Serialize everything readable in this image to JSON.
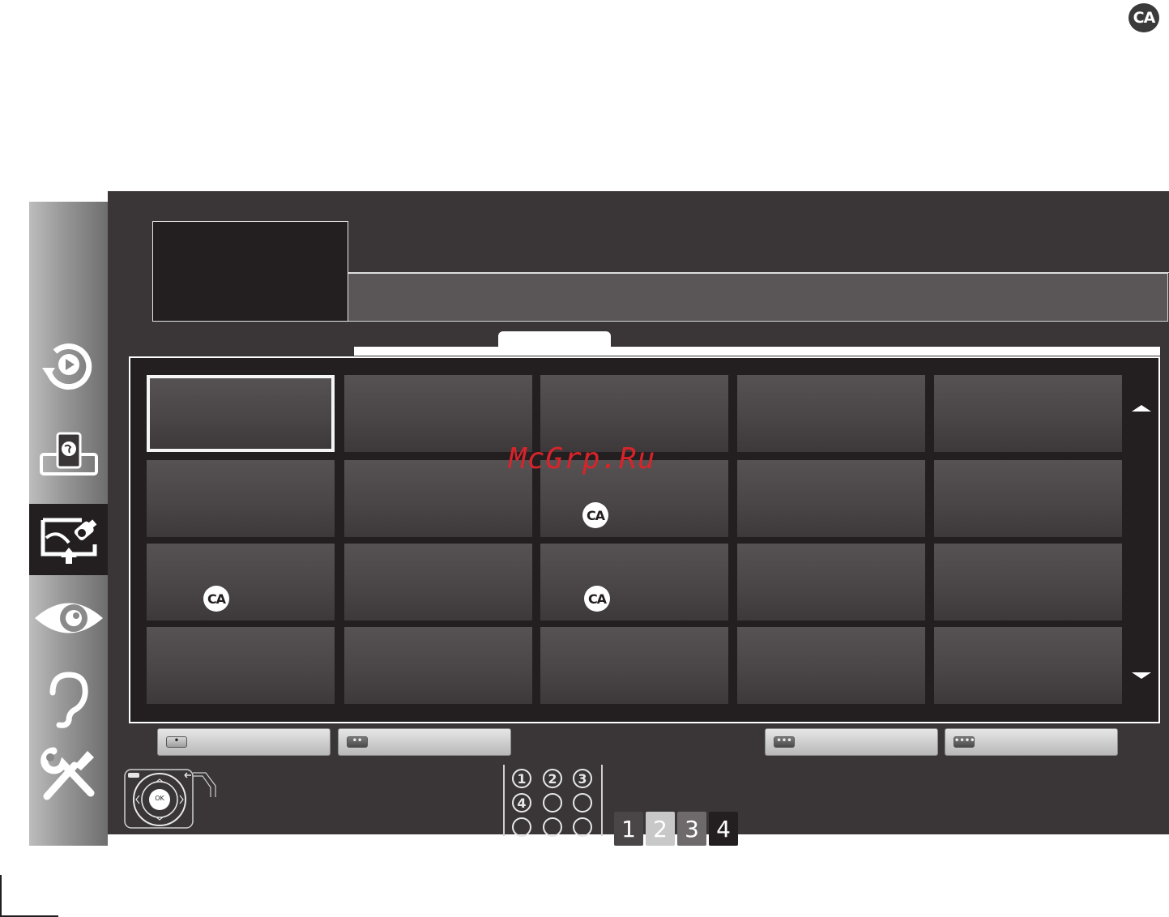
{
  "page_badge": "CA",
  "sidebar": {
    "items": [
      {
        "name": "media-playback",
        "icon": "play-circle-icon",
        "active": false
      },
      {
        "name": "internet",
        "icon": "globe-devices-icon",
        "active": false
      },
      {
        "name": "source",
        "icon": "antenna-cable-icon",
        "active": true
      },
      {
        "name": "picture",
        "icon": "eye-icon",
        "active": false
      },
      {
        "name": "sound",
        "icon": "ear-icon",
        "active": false
      },
      {
        "name": "settings",
        "icon": "tools-icon",
        "active": false
      }
    ]
  },
  "grid": {
    "ca_label": "CA",
    "selected_cell": "r0c0",
    "ca_cells": [
      "r1c2",
      "r2c0",
      "r2c2"
    ]
  },
  "color_buttons": [
    {
      "key": "red",
      "dots": "•"
    },
    {
      "key": "green",
      "dots": "••"
    },
    {
      "key": "yellow",
      "dots": "•••"
    },
    {
      "key": "blue",
      "dots": "••••"
    }
  ],
  "remote": {
    "ok_label": "OK"
  },
  "keypad": {
    "keys": [
      "1",
      "2",
      "3",
      "4",
      "",
      "",
      "",
      "",
      ""
    ]
  },
  "page_tabs": [
    "1",
    "2",
    "3",
    "4"
  ],
  "watermark": "McGrp.Ru",
  "colors": {
    "screen_bg": "#3a3637",
    "grid_bg": "#231f20",
    "cell": "#4a4647",
    "highlight": "#ffffff",
    "watermark": "#d8232a"
  }
}
